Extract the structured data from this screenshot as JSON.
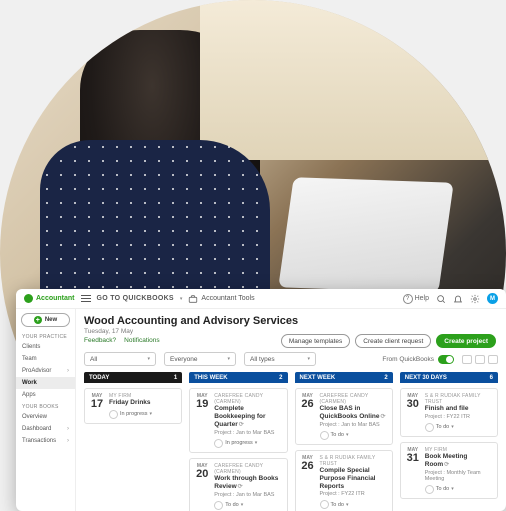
{
  "topbar": {
    "brand": "Accountant",
    "go_to": "GO TO QUICKBOOKS",
    "tools": "Accountant Tools",
    "help": "Help",
    "avatar_initial": "M"
  },
  "sidebar": {
    "new_btn": "New",
    "section_practice": "YOUR PRACTICE",
    "items_practice": [
      {
        "label": "Clients"
      },
      {
        "label": "Team"
      },
      {
        "label": "ProAdvisor"
      },
      {
        "label": "Work"
      },
      {
        "label": "Apps"
      }
    ],
    "section_books": "YOUR BOOKS",
    "items_books": [
      {
        "label": "Overview"
      },
      {
        "label": "Dashboard"
      },
      {
        "label": "Transactions"
      }
    ]
  },
  "page": {
    "title": "Wood Accounting and Advisory Services",
    "date": "Tuesday, 17 May",
    "tab_feedback": "Feedback?",
    "tab_notifications": "Notifications"
  },
  "actions": {
    "manage_templates": "Manage templates",
    "client_request": "Create client request",
    "create_project": "Create project"
  },
  "filters": {
    "f1": "All",
    "f2": "Everyone",
    "f3": "All types",
    "firm_label": "From QuickBooks"
  },
  "columns": [
    {
      "header": "TODAY",
      "count": "1"
    },
    {
      "header": "THIS WEEK",
      "count": "2"
    },
    {
      "header": "NEXT WEEK",
      "count": "2"
    },
    {
      "header": "NEXT 30 DAYS",
      "count": "6"
    }
  ],
  "cards": {
    "c1": {
      "month": "MAY",
      "day": "17",
      "client": "MY FIRM",
      "title": "Friday Drinks",
      "status": "In progress"
    },
    "c2": {
      "month": "MAY",
      "day": "19",
      "client": "CAREFREE CANDY (CARMEN)",
      "title": "Complete Bookkeeping for Quarter",
      "meta": "Project : Jan to Mar BAS",
      "status": "In progress"
    },
    "c3": {
      "month": "MAY",
      "day": "20",
      "client": "CAREFREE CANDY (CARMEN)",
      "title": "Work through Books Review",
      "meta": "Project : Jan to Mar BAS",
      "status": "To do"
    },
    "c4": {
      "month": "MAY",
      "day": "26",
      "client": "CAREFREE CANDY (CARMEN)",
      "title": "Close BAS in QuickBooks Online",
      "meta": "Project : Jan to Mar BAS",
      "status": "To do"
    },
    "c5": {
      "month": "MAY",
      "day": "26",
      "client": "S & R RUDIAK FAMILY TRUST",
      "title": "Compile Special Purpose Financial Reports",
      "meta": "Project : FY22 ITR",
      "status": "To do"
    },
    "c6": {
      "month": "MAY",
      "day": "30",
      "client": "S & R RUDIAK FAMILY TRUST",
      "title": "Finish and file",
      "meta": "Project : FY22 ITR",
      "status": "To do"
    },
    "c7": {
      "month": "MAY",
      "day": "31",
      "client": "MY FIRM",
      "title": "Book Meeting Room",
      "meta": "Project : Monthly Team Meeting",
      "status": "To do"
    }
  }
}
